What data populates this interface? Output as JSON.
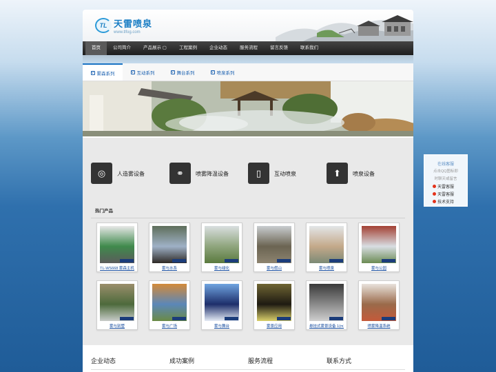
{
  "brand": {
    "logo_mark": "TL",
    "name": "天雷喷泉",
    "url": "www.tlfog.com"
  },
  "nav": {
    "items": [
      {
        "label": "首页",
        "active": true
      },
      {
        "label": "公司简介"
      },
      {
        "label": "产品展示 ▢"
      },
      {
        "label": "工程案例"
      },
      {
        "label": "企业动态"
      },
      {
        "label": "服务流程"
      },
      {
        "label": "留言反馈"
      },
      {
        "label": "联系我们"
      }
    ]
  },
  "tabs": [
    {
      "label": "雾森系列",
      "active": true
    },
    {
      "label": "互动系列"
    },
    {
      "label": "舞台系列"
    },
    {
      "label": "喷泉系列"
    }
  ],
  "features": [
    {
      "label": "人造雾设备",
      "icon": "life-ring-icon"
    },
    {
      "label": "喷雾降温设备",
      "icon": "link-icon"
    },
    {
      "label": "互动喷泉",
      "icon": "phone-icon"
    },
    {
      "label": "喷泉设备",
      "icon": "upload-icon"
    }
  ],
  "hot_products": {
    "title": "热门产品",
    "items": [
      {
        "label": "TL-WS668 雾森主机"
      },
      {
        "label": "雾与水系"
      },
      {
        "label": "雾与绿化"
      },
      {
        "label": "雾与假山"
      },
      {
        "label": "雾与喷泉"
      },
      {
        "label": "雾与公园"
      },
      {
        "label": "雾与别墅"
      },
      {
        "label": "雾与广场"
      },
      {
        "label": "雾与舞台"
      },
      {
        "label": "雾景应用"
      },
      {
        "label": "悬挂式雾景设备 1(m)"
      },
      {
        "label": "喷雾降温系统"
      }
    ]
  },
  "footer": {
    "columns": [
      {
        "label": "企业动态"
      },
      {
        "label": "成功案例"
      },
      {
        "label": "服务流程"
      },
      {
        "label": "联系方式"
      }
    ]
  },
  "service": {
    "title": "在线客服",
    "desc1": "点击QQ图标即",
    "desc2": "时聊天或留言",
    "items": [
      {
        "label": "天雷客服"
      },
      {
        "label": "天雷客服"
      },
      {
        "label": "技术支持"
      }
    ]
  }
}
